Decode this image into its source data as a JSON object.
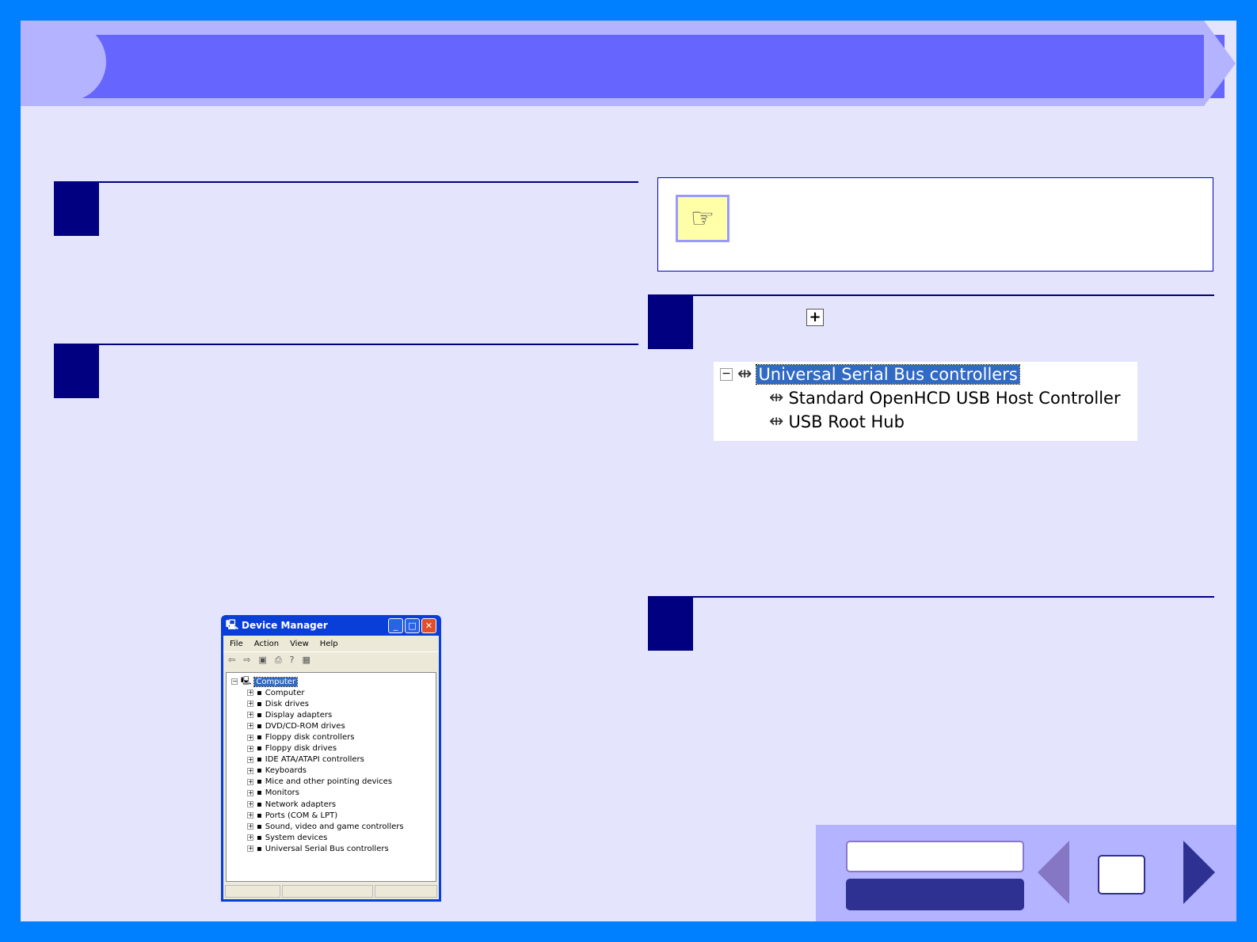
{
  "usb_tree": {
    "category": "Universal Serial Bus controllers",
    "children": [
      "Standard OpenHCD USB Host Controller",
      "USB Root Hub"
    ]
  },
  "device_manager": {
    "title": "Device Manager",
    "menu": [
      "File",
      "Action",
      "View",
      "Help"
    ],
    "root": "Computer",
    "items": [
      "Computer",
      "Disk drives",
      "Display adapters",
      "DVD/CD-ROM drives",
      "Floppy disk controllers",
      "Floppy disk drives",
      "IDE ATA/ATAPI controllers",
      "Keyboards",
      "Mice and other pointing devices",
      "Monitors",
      "Network adapters",
      "Ports (COM & LPT)",
      "Sound, video and game controllers",
      "System devices",
      "Universal Serial Bus controllers"
    ]
  },
  "icons": {
    "note": "pointing-hand-icon",
    "expand": "plus-box-icon",
    "usb": "usb-icon"
  }
}
